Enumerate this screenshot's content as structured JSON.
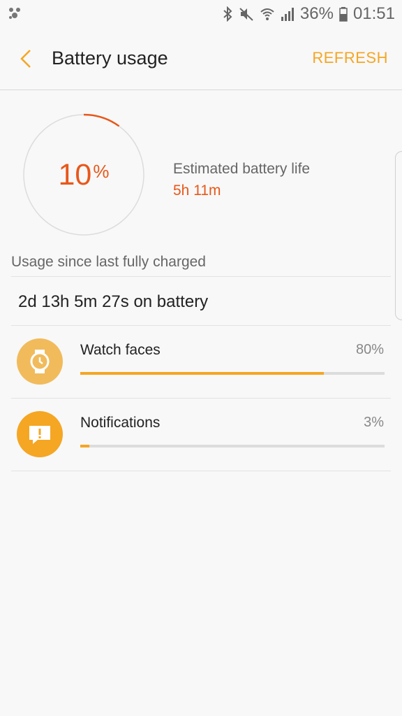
{
  "status_bar": {
    "battery_percent": "36%",
    "time": "01:51",
    "icons": [
      "samsung-gear-icon",
      "bluetooth-icon",
      "mute-icon",
      "wifi-icon",
      "signal-icon",
      "battery-icon"
    ]
  },
  "header": {
    "title": "Battery usage",
    "refresh_label": "REFRESH"
  },
  "battery_gauge": {
    "percent_value": "10",
    "percent_symbol": "%",
    "level": 0.1,
    "estimated_label": "Estimated battery life",
    "estimated_value": "5h 11m"
  },
  "usage": {
    "header": "Usage since last fully charged",
    "on_battery": "2d 13h 5m 27s on battery",
    "items": [
      {
        "name": "Watch faces",
        "percent": "80%",
        "level": 0.8,
        "icon": "watch-icon",
        "icon_color": "#f1bb5c"
      },
      {
        "name": "Notifications",
        "percent": "3%",
        "level": 0.03,
        "icon": "notification-icon",
        "icon_color": "#f5a623"
      }
    ]
  },
  "colors": {
    "accent": "#f5a623",
    "gauge": "#e8571a",
    "text": "#222222",
    "secondary_text": "#666666"
  }
}
